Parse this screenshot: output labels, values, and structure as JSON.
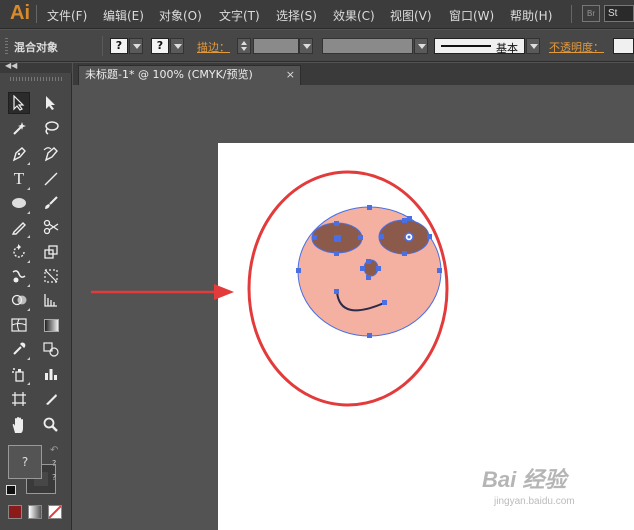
{
  "app": {
    "logo": "Ai",
    "bridge_label": "Br",
    "stock_label": "St"
  },
  "menu": [
    "文件(F)",
    "编辑(E)",
    "对象(O)",
    "文字(T)",
    "选择(S)",
    "效果(C)",
    "视图(V)",
    "窗口(W)",
    "帮助(H)"
  ],
  "control_bar": {
    "mode_label": "混合对象",
    "fill_placeholder": "?",
    "stroke_placeholder": "?",
    "stroke_label": "描边：",
    "stroke_style_label": "基本",
    "opacity_label": "不透明度："
  },
  "document_tab": {
    "title": "未标题-1* @ 100% (CMYK/预览)",
    "close": "×"
  },
  "tools": {
    "left": [
      "selection-tool",
      "magic-wand-tool",
      "pen-tool",
      "type-tool",
      "ellipse-tool",
      "pencil-tool",
      "rotate-tool",
      "warp-tool",
      "shape-builder-tool",
      "mesh-tool",
      "eyedropper-tool",
      "symbol-sprayer-tool",
      "artboard-tool",
      "hand-tool"
    ],
    "right": [
      "direct-selection-tool",
      "lasso-tool",
      "curvature-tool",
      "line-segment-tool",
      "paintbrush-tool",
      "scissors-tool",
      "scale-tool",
      "free-transform-tool",
      "perspective-grid-tool",
      "gradient-tool",
      "blend-tool",
      "column-graph-tool",
      "slice-tool",
      "zoom-tool"
    ]
  },
  "fill_stroke": {
    "fill_placeholder": "?",
    "stroke_placeholder": "?",
    "mini_q": "?"
  },
  "colors": {
    "accent": "#d98a2b",
    "label_orange": "#e39a3c",
    "face": "#f4b0a0",
    "eye": "#8b5a4a",
    "selection": "#4a6fe3",
    "highlight_circle": "#e33b3b",
    "arrow": "#e33b3b",
    "swatch_color": "#8b1a1a"
  },
  "watermark": {
    "main": "Bai 经验",
    "sub": "jingyan.baidu.com"
  }
}
